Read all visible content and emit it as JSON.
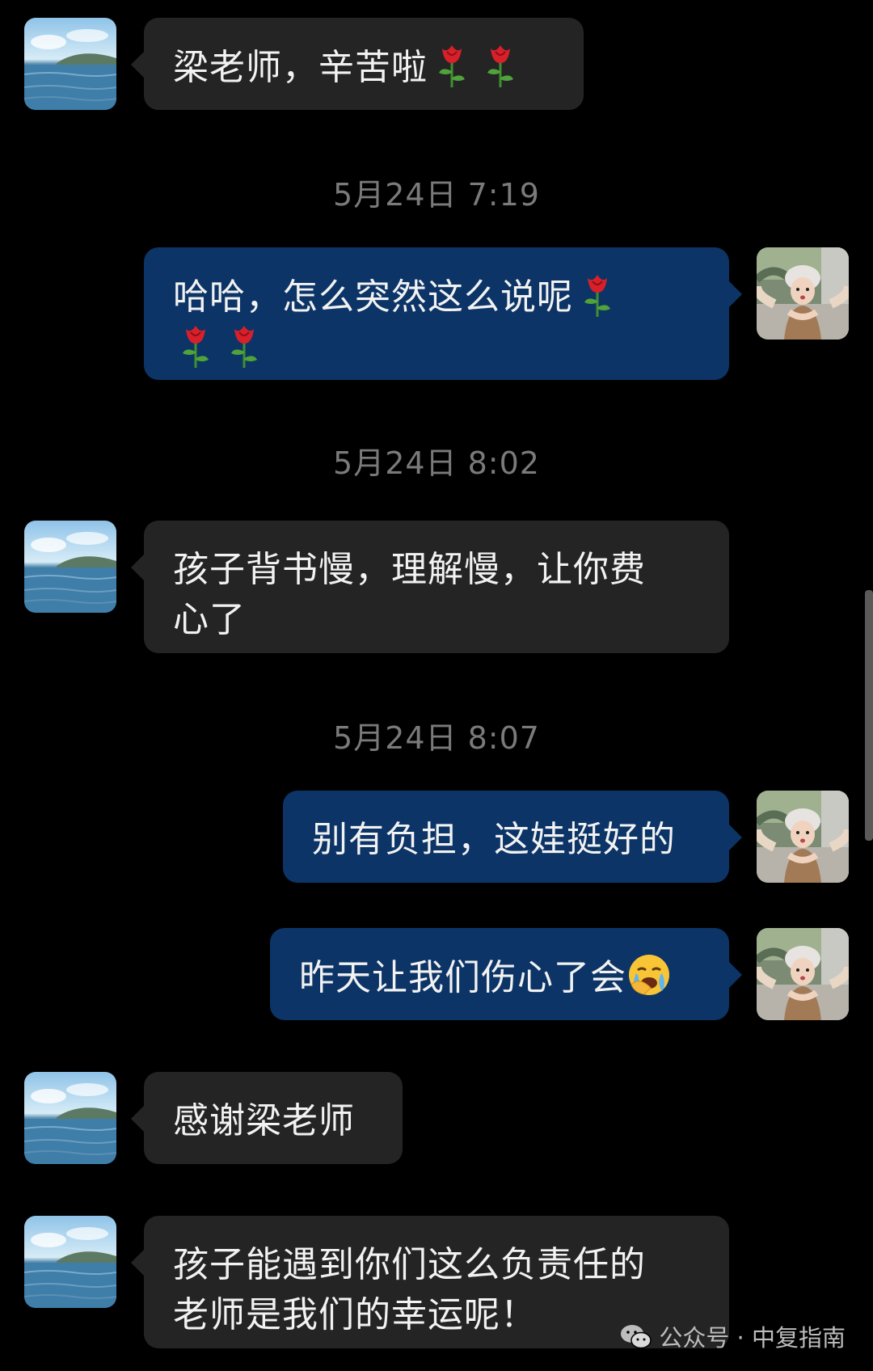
{
  "messages": [
    {
      "type": "in",
      "text": "梁老师，辛苦啦",
      "roses": 2
    },
    {
      "type": "time",
      "text": "5月24日 7:19"
    },
    {
      "type": "out",
      "line1": "哈哈，怎么突然这么说呢"
    },
    {
      "type": "time",
      "text": "5月24日 8:02"
    },
    {
      "type": "in",
      "line1": "孩子背书慢，理解慢，让你费",
      "line2": "心了"
    },
    {
      "type": "time",
      "text": "5月24日 8:07"
    },
    {
      "type": "out",
      "text": "别有负担，这娃挺好的"
    },
    {
      "type": "out",
      "text": "昨天让我们伤心了会"
    },
    {
      "type": "in",
      "text": "感谢梁老师"
    },
    {
      "type": "in",
      "line1": "孩子能遇到你们这么负责任的",
      "line2": "老师是我们的幸运呢！"
    }
  ],
  "watermark": {
    "text": "公众号 · 中复指南",
    "icon": "wechat-icon"
  },
  "icons": {
    "rose": "rose-emoji-icon",
    "crying": "crying-face-emoji-icon"
  },
  "colors": {
    "background": "#000000",
    "incoming_bubble": "#242424",
    "outgoing_bubble": "#0c3466",
    "timestamp": "#7a7a7a"
  }
}
